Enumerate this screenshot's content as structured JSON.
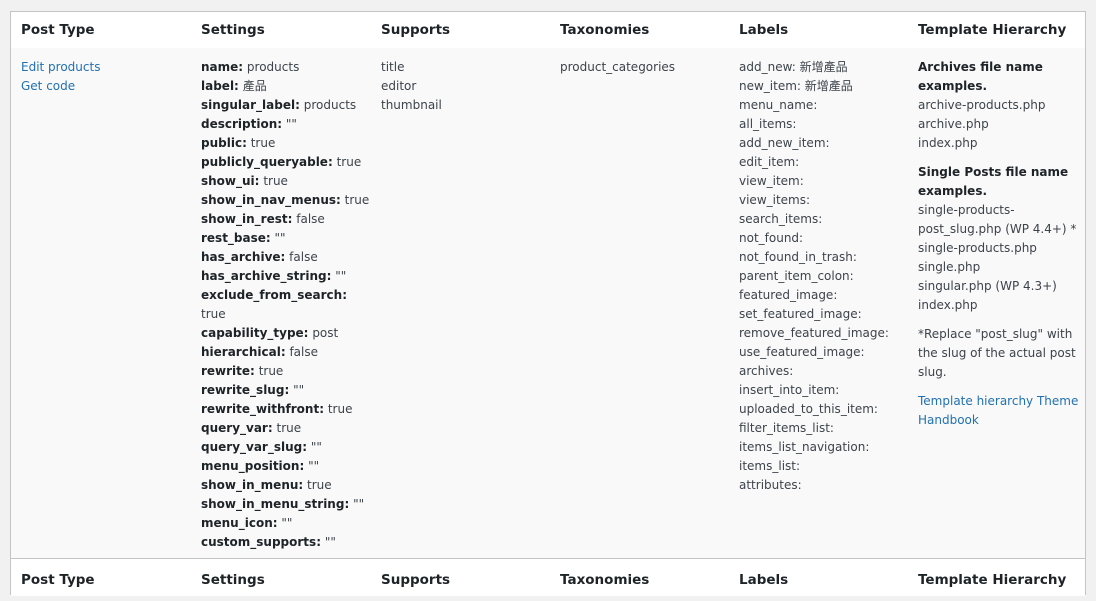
{
  "headers": [
    "Post Type",
    "Settings",
    "Supports",
    "Taxonomies",
    "Labels",
    "Template Hierarchy"
  ],
  "post_type": {
    "links": [
      "Edit products",
      "Get code"
    ]
  },
  "settings": [
    {
      "k": "name:",
      "v": "products"
    },
    {
      "k": "label:",
      "v": "產品"
    },
    {
      "k": "singular_label:",
      "v": "products"
    },
    {
      "k": "description:",
      "v": "\"\""
    },
    {
      "k": "public:",
      "v": "true"
    },
    {
      "k": "publicly_queryable:",
      "v": "true"
    },
    {
      "k": "show_ui:",
      "v": "true"
    },
    {
      "k": "show_in_nav_menus:",
      "v": "true"
    },
    {
      "k": "show_in_rest:",
      "v": "false"
    },
    {
      "k": "rest_base:",
      "v": "\"\""
    },
    {
      "k": "has_archive:",
      "v": "false"
    },
    {
      "k": "has_archive_string:",
      "v": "\"\""
    },
    {
      "k": "exclude_from_search:",
      "v": ""
    },
    {
      "k": "",
      "v": "true"
    },
    {
      "k": "capability_type:",
      "v": "post"
    },
    {
      "k": "hierarchical:",
      "v": "false"
    },
    {
      "k": "rewrite:",
      "v": "true"
    },
    {
      "k": "rewrite_slug:",
      "v": "\"\""
    },
    {
      "k": "rewrite_withfront:",
      "v": "true"
    },
    {
      "k": "query_var:",
      "v": "true"
    },
    {
      "k": "query_var_slug:",
      "v": "\"\""
    },
    {
      "k": "menu_position:",
      "v": "\"\""
    },
    {
      "k": "show_in_menu:",
      "v": "true"
    },
    {
      "k": "show_in_menu_string:",
      "v": "\"\""
    },
    {
      "k": "menu_icon:",
      "v": "\"\""
    },
    {
      "k": "custom_supports:",
      "v": "\"\""
    }
  ],
  "supports": [
    "title",
    "editor",
    "thumbnail"
  ],
  "taxonomies": [
    "product_categories"
  ],
  "labels": [
    "add_new: 新增產品",
    "new_item: 新增產品",
    "menu_name:",
    "all_items:",
    "add_new_item:",
    "edit_item:",
    "view_item:",
    "view_items:",
    "search_items:",
    "not_found:",
    "not_found_in_trash:",
    "parent_item_colon:",
    "featured_image:",
    "set_featured_image:",
    "remove_featured_image:",
    "use_featured_image:",
    "archives:",
    "insert_into_item:",
    "uploaded_to_this_item:",
    "filter_items_list:",
    "items_list_navigation:",
    "items_list:",
    "attributes:"
  ],
  "template": {
    "archives_heading": "Archives file name examples.",
    "archives_files": [
      "archive-products.php",
      "archive.php",
      "index.php"
    ],
    "single_heading": "Single Posts file name examples.",
    "single_files": [
      "single-products-post_slug.php (WP 4.4+) *",
      "single-products.php",
      "single.php",
      "singular.php (WP 4.3+)",
      "index.php"
    ],
    "note": "*Replace \"post_slug\" with the slug of the actual post slug.",
    "link": "Template hierarchy Theme Handbook"
  },
  "colors": {
    "link": "#2271b1",
    "border": "#c3c4c7",
    "row_bg": "#f9f9f9"
  }
}
